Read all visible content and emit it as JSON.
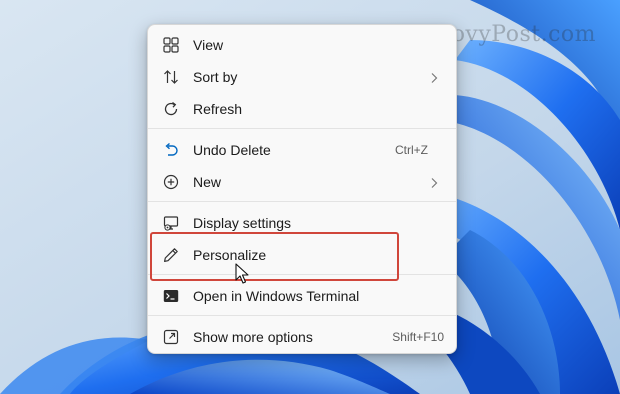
{
  "watermark": "groovyPost.com",
  "menu": {
    "items": [
      {
        "label": "View",
        "icon": "view-icon"
      },
      {
        "label": "Sort by",
        "icon": "sort-icon",
        "submenu": true
      },
      {
        "label": "Refresh",
        "icon": "refresh-icon"
      },
      {
        "label": "Undo Delete",
        "icon": "undo-icon",
        "shortcut": "Ctrl+Z"
      },
      {
        "label": "New",
        "icon": "new-icon",
        "submenu": true
      },
      {
        "label": "Display settings",
        "icon": "display-icon"
      },
      {
        "label": "Personalize",
        "icon": "personalize-icon"
      },
      {
        "label": "Open in Windows Terminal",
        "icon": "terminal-icon"
      },
      {
        "label": "Show more options",
        "icon": "more-options-icon",
        "shortcut": "Shift+F10"
      }
    ]
  },
  "colors": {
    "accent": "#0067c0",
    "highlight_box": "#d0463b",
    "menu_bg": "#f9f9f9",
    "wallpaper": "#0b5ed8"
  }
}
